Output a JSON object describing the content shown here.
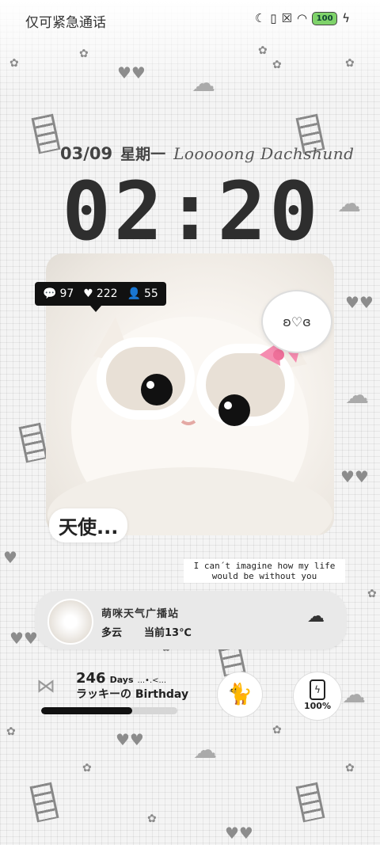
{
  "status_bar": {
    "carrier_text": "仅可紧急通话",
    "battery_level": "100",
    "icons": [
      "moon-icon",
      "vibrate-icon",
      "sim-off-icon",
      "wifi-icon",
      "battery-icon",
      "charging-icon"
    ]
  },
  "lockscreen": {
    "date": "03/09",
    "weekday": "星期一",
    "brand_text": "Looooong Dachshund",
    "time": "02:20"
  },
  "photo_card": {
    "stats": {
      "comments": "97",
      "likes": "222",
      "followers": "55"
    },
    "thought_bubble": "ʚ♡ɞ",
    "angel_text": "天使...",
    "quote": "I can´t imagine how my life would be without you"
  },
  "weather_card": {
    "title": "萌咪天气广播站",
    "condition": "多云",
    "temperature": "当前13℃",
    "icon": "cloud-icon"
  },
  "countdown": {
    "days": "246",
    "unit": "Days",
    "decor": "...•.<...",
    "event": "ラッキーの Birthday",
    "progress": 0.67
  },
  "battery_widget": {
    "level_text": "100%"
  },
  "colors": {
    "accent": "#111111",
    "background": "#f4f4f4",
    "progress_track": "#d6d6d6"
  }
}
